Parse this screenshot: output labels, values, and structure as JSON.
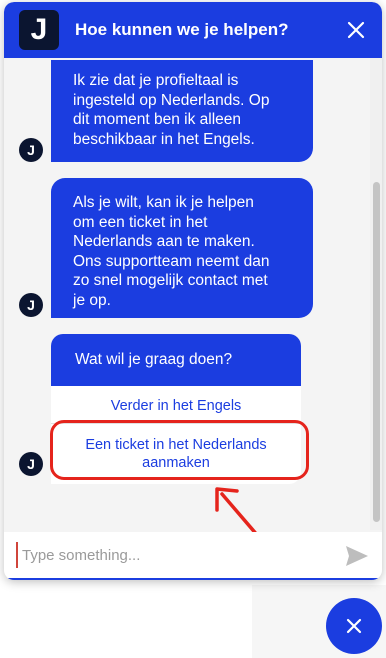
{
  "header": {
    "logo_letter": "J",
    "title": "Hoe kunnen we je helpen?"
  },
  "messages": [
    {
      "lines": [
        "Ik zie dat je profieltaal is",
        "ingesteld op Nederlands. Op",
        "dit moment ben ik alleen",
        "beschikbaar in het Engels."
      ]
    },
    {
      "lines": [
        "Als je wilt, kan ik je helpen",
        "om een ticket in het",
        "Nederlands aan te maken.",
        "Ons supportteam neemt dan",
        "zo snel mogelijk contact met",
        "je op."
      ]
    }
  ],
  "avatar_letter": "J",
  "choice_card": {
    "question": "Wat wil je graag doen?",
    "option_1": "Verder in het Engels",
    "option_2_lines": [
      "Een ticket in het Nederlands",
      "aanmaken"
    ]
  },
  "composer": {
    "placeholder": "Type something..."
  },
  "icons": {
    "close": "close-icon",
    "send": "send-icon",
    "launcher_close": "close-icon",
    "annotation": "arrow-icon"
  },
  "colors": {
    "brand": "#1b3de0",
    "logo_bg": "#0b1530",
    "highlight": "#e5241c"
  }
}
